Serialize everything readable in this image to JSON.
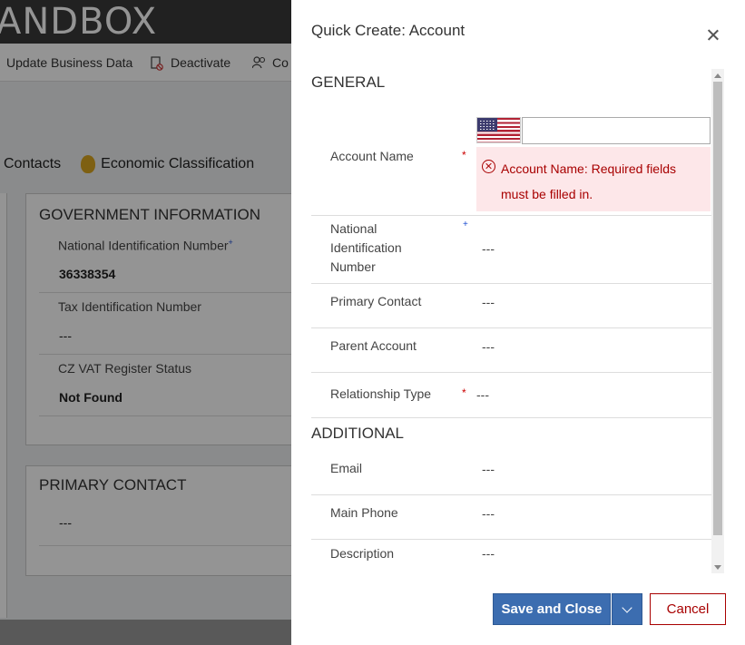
{
  "background": {
    "brand": "ANDBOX",
    "command_bar": [
      {
        "label": "Update Business Data",
        "icon": "refresh-icon"
      },
      {
        "label": "Deactivate",
        "icon": "deactivate-icon"
      },
      {
        "label": "Co",
        "icon": "contacts-icon"
      }
    ],
    "tabs": [
      {
        "label": "Contacts"
      },
      {
        "label": "Economic Classification",
        "icon": "money-bag-icon"
      }
    ],
    "government_card": {
      "title": "GOVERNMENT INFORMATION",
      "fields": [
        {
          "label": "National Identification Number",
          "marker": "+",
          "value": "36338354"
        },
        {
          "label": "Tax Identification Number",
          "value": "---"
        },
        {
          "label": "CZ VAT Register Status",
          "value": "Not Found"
        }
      ]
    },
    "primary_contact_card": {
      "title": "PRIMARY CONTACT",
      "value": "---"
    }
  },
  "dialog": {
    "title": "Quick Create: Account",
    "sections": {
      "general": "GENERAL",
      "additional": "ADDITIONAL"
    },
    "fields": {
      "account_name": {
        "label": "Account Name",
        "required": "*",
        "value": "",
        "error": "Account Name: Required fields must be filled in."
      },
      "national_id": {
        "label": "National Identification Number",
        "marker": "+",
        "value": "---"
      },
      "primary_contact": {
        "label": "Primary Contact",
        "value": "---"
      },
      "parent_account": {
        "label": "Parent Account",
        "value": "---"
      },
      "relationship_type": {
        "label": "Relationship Type",
        "required": "*",
        "value": "---"
      },
      "email": {
        "label": "Email",
        "value": "---"
      },
      "main_phone": {
        "label": "Main Phone",
        "value": "---"
      },
      "description": {
        "label": "Description",
        "value": "---"
      }
    },
    "buttons": {
      "save_close": "Save and Close",
      "cancel": "Cancel"
    },
    "colors": {
      "primary": "#3c6db0",
      "error": "#a80000",
      "error_bg": "#fde7e9"
    }
  }
}
